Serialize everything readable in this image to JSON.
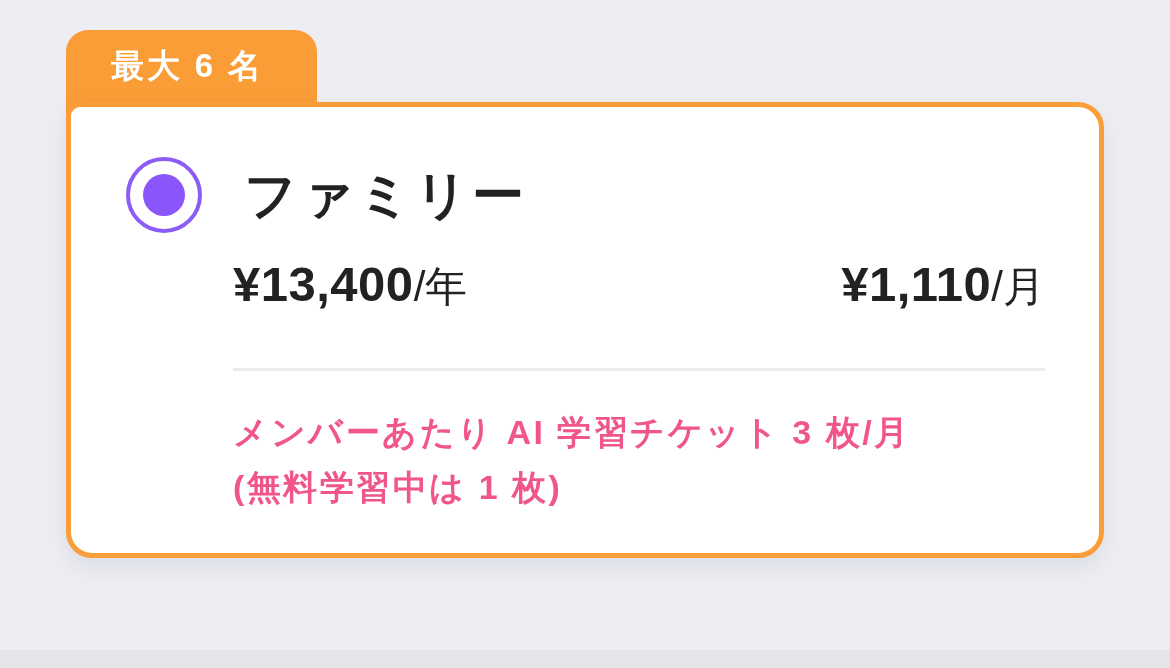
{
  "plan": {
    "badge": "最大 6 名",
    "selected": true,
    "name": "ファミリー",
    "price_yearly": "**¥13,400**/年",
    "price_monthly": "**¥1,110**/月",
    "note": "メンバーあたり AI 学習チケット 3 枚/月\n(無料学習中は 1 枚)"
  }
}
